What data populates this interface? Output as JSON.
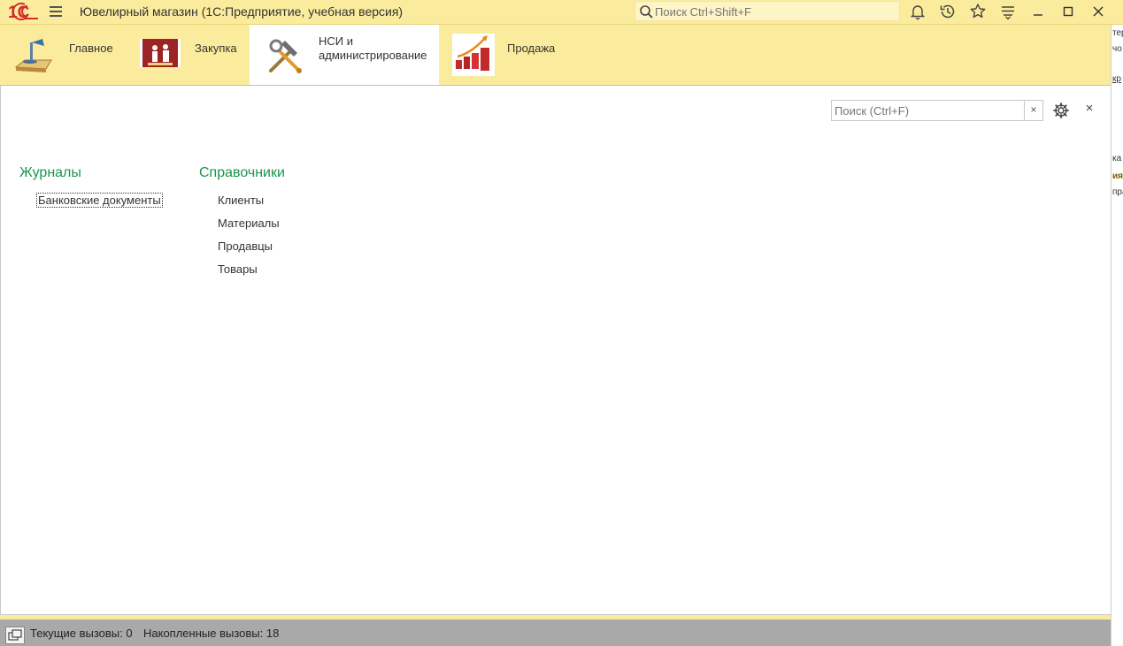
{
  "window": {
    "title": "Ювелирный магазин  (1С:Предприятие, учебная версия)",
    "search_placeholder": "Поиск Ctrl+Shift+F",
    "logo_text": "1C"
  },
  "sections": [
    {
      "label": "Главное",
      "icon": "desk-lamp-icon",
      "active": false
    },
    {
      "label": "Закупка",
      "icon": "purchase-icon",
      "active": false
    },
    {
      "label_line1": "НСИ и",
      "label_line2": "администрирование",
      "icon": "tools-icon",
      "active": true
    },
    {
      "label": "Продажа",
      "icon": "sales-chart-icon",
      "active": false
    }
  ],
  "panel": {
    "search_placeholder": "Поиск (Ctrl+F)",
    "clear_label": "×",
    "close_label": "×",
    "groups": [
      {
        "title": "Журналы",
        "items": [
          "Банковские документы"
        ]
      },
      {
        "title": "Справочники",
        "items": [
          "Клиенты",
          "Материалы",
          "Продавцы",
          "Товары"
        ]
      }
    ]
  },
  "statusbar": {
    "current_calls": "Текущие вызовы: 0",
    "accumulated_calls": "Накопленные вызовы: 18"
  },
  "right_strip": [
    "тер",
    "чо",
    "кр",
    "ка",
    "ия",
    "пра"
  ],
  "colors": {
    "accent_green": "#19964c",
    "header_bg": "#fbec9d",
    "status_bg": "#a9a9a9"
  }
}
